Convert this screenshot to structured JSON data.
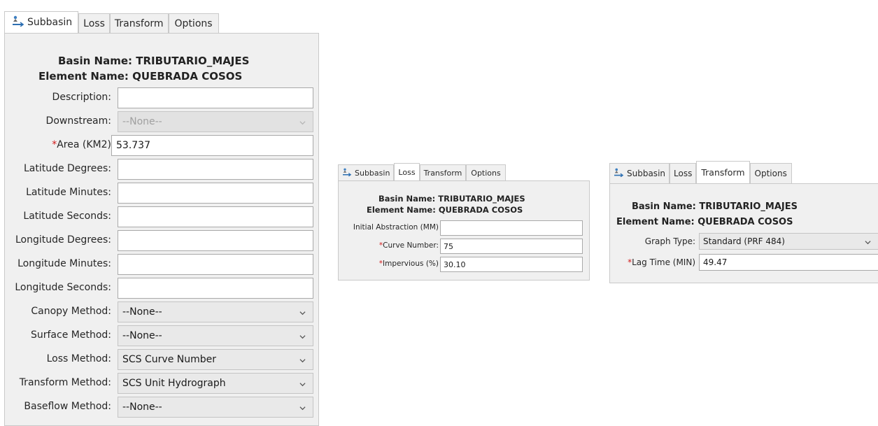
{
  "tab_labels": {
    "subbasin": "Subbasin",
    "loss": "Loss",
    "transform": "Transform",
    "options": "Options"
  },
  "basin_name_line": "Basin Name: TRIBUTARIO_MAJES",
  "element_name_line": "Element Name: QUEBRADA COSOS",
  "required_marker": "*",
  "subbasin_panel": {
    "active_tab": "Subbasin",
    "fields": [
      {
        "label": "Description:",
        "value": ""
      },
      {
        "label": "Downstream:",
        "value": "--None--",
        "disabled": true,
        "dropdown": true
      },
      {
        "label": "Area (KM2)",
        "value": "53.737",
        "required": true
      },
      {
        "label": "Latitude Degrees:",
        "value": ""
      },
      {
        "label": "Latitude Minutes:",
        "value": ""
      },
      {
        "label": "Latitude Seconds:",
        "value": ""
      },
      {
        "label": "Longitude Degrees:",
        "value": ""
      },
      {
        "label": "Longitude Minutes:",
        "value": ""
      },
      {
        "label": "Longitude Seconds:",
        "value": ""
      },
      {
        "label": "Canopy Method:",
        "value": "--None--",
        "dropdown": true
      },
      {
        "label": "Surface Method:",
        "value": "--None--",
        "dropdown": true
      },
      {
        "label": "Loss Method:",
        "value": "SCS Curve Number",
        "dropdown": true
      },
      {
        "label": "Transform Method:",
        "value": "SCS Unit Hydrograph",
        "dropdown": true
      },
      {
        "label": "Baseflow Method:",
        "value": "--None--",
        "dropdown": true
      }
    ]
  },
  "loss_panel": {
    "active_tab": "Loss",
    "fields": [
      {
        "label": "Initial Abstraction (MM)",
        "value": ""
      },
      {
        "label": "Curve Number:",
        "value": "75",
        "required": true
      },
      {
        "label": "Impervious (%)",
        "value": "30.10",
        "required": true
      }
    ]
  },
  "transform_panel": {
    "active_tab": "Transform",
    "fields": [
      {
        "label": "Graph Type:",
        "value": "Standard (PRF 484)",
        "dropdown": true
      },
      {
        "label": "Lag Time (MIN)",
        "value": "49.47",
        "required": true
      }
    ]
  },
  "colors": {
    "tab_active": "#ffffff",
    "panel_bg": "#f0f0f0",
    "required_asterisk": "#d11a1a",
    "border": "#a9a9a9"
  },
  "icons": {
    "subbasin_tab": "subbasin-icon",
    "dropdown": "chevron-down-icon"
  }
}
